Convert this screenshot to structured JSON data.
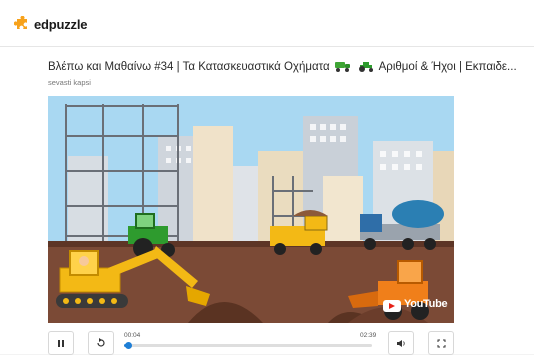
{
  "app": {
    "brand": "edpuzzle"
  },
  "video": {
    "title_text": "Βλέπω και Μαθαίνω #34 | Τα Κατασκευαστικά Οχήματα",
    "title_suffix": "Αριθμοί & Ήχοι | Εκπαιδε...",
    "title_emojis": [
      "dump-truck-emoji",
      "tractor-emoji"
    ],
    "author": "sevasti kapsi",
    "watermark": "YouTube",
    "progress_fraction": 0.017
  },
  "player": {
    "current_time": "00:04",
    "duration": "02:39",
    "buttons": [
      "pause",
      "replay",
      "volume",
      "fullscreen"
    ]
  },
  "colors": {
    "brand_orange": "#f7a21b",
    "progress_blue": "#1f7fd6",
    "sky": "#a9d8f2",
    "ground": "#7b4a36"
  }
}
